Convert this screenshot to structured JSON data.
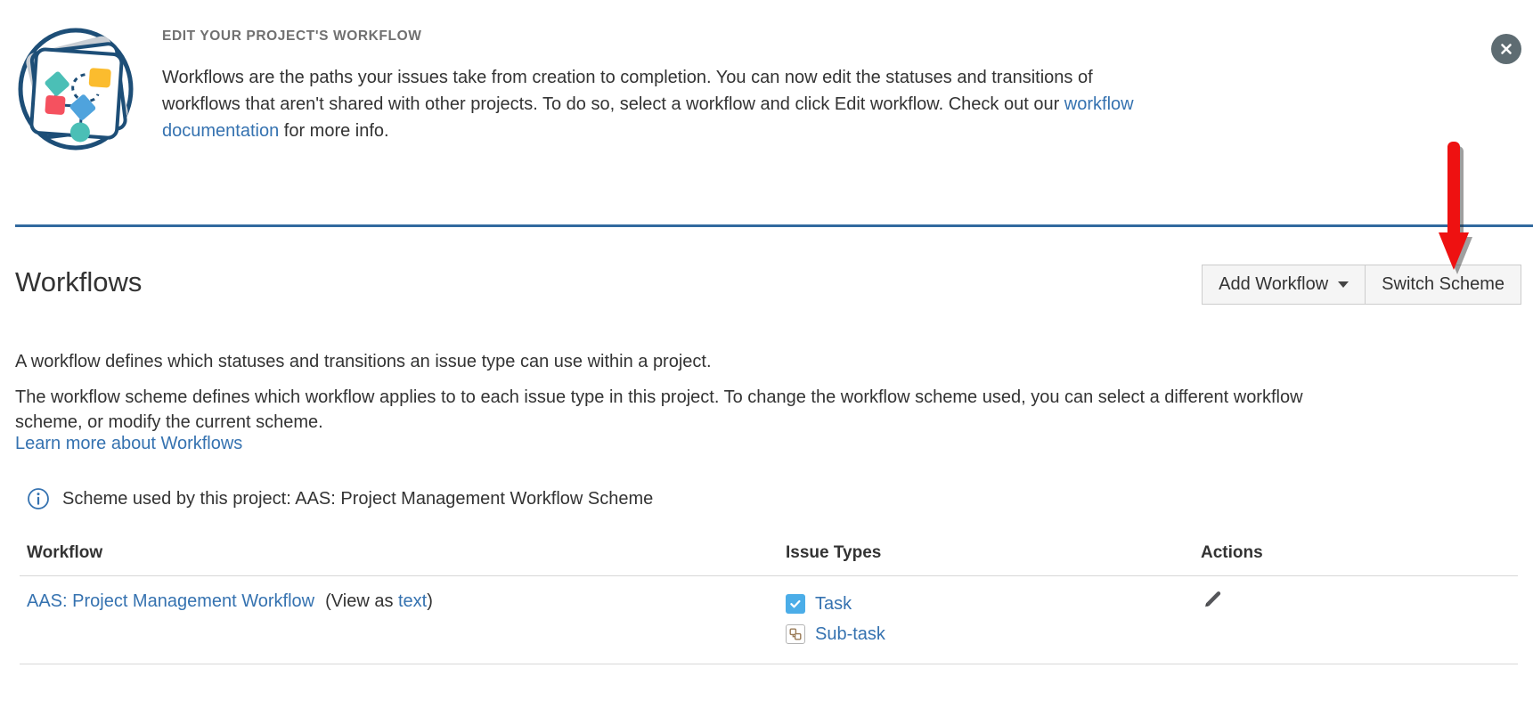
{
  "banner": {
    "kicker": "EDIT YOUR PROJECT'S WORKFLOW",
    "body_part1": "Workflows are the paths your issues take from creation to completion. You can now edit the statuses and transitions of workflows that aren't shared with other projects. To do so, select a workflow and click Edit workflow. Check out our ",
    "doc_link": "workflow documentation",
    "body_part2": " for more info.",
    "close_icon": "close-icon",
    "illustration": "workflow-illustration"
  },
  "header": {
    "title": "Workflows",
    "add_workflow_label": "Add Workflow",
    "switch_scheme_label": "Switch Scheme",
    "caret_icon": "chevron-down-icon"
  },
  "description": {
    "paragraph1": "A workflow defines which statuses and transitions an issue type can use within a project.",
    "paragraph2": "The workflow scheme defines which workflow applies to to each issue type in this project. To change the workflow scheme used, you can select a different workflow scheme, or modify the current scheme.",
    "learn_more": "Learn more about Workflows"
  },
  "info": {
    "icon": "info-icon",
    "text": "Scheme used by this project: AAS: Project Management Workflow Scheme"
  },
  "table": {
    "columns": {
      "workflow": "Workflow",
      "issue_types": "Issue Types",
      "actions": "Actions"
    },
    "rows": [
      {
        "workflow_name": "AAS: Project Management Workflow",
        "view_as_prefix": "(View as ",
        "view_as_link": "text",
        "view_as_suffix": ")",
        "issue_types": [
          {
            "label": "Task",
            "icon": "task-icon"
          },
          {
            "label": "Sub-task",
            "icon": "subtask-icon"
          }
        ],
        "action_icon": "edit-pencil-icon"
      }
    ]
  },
  "annotation": {
    "arrow": "red-down-arrow",
    "color": "#ee1111"
  },
  "colors": {
    "link": "#3572b0",
    "divider": "#31699e",
    "task_icon": "#4bade8",
    "annotation": "#ee1111"
  }
}
